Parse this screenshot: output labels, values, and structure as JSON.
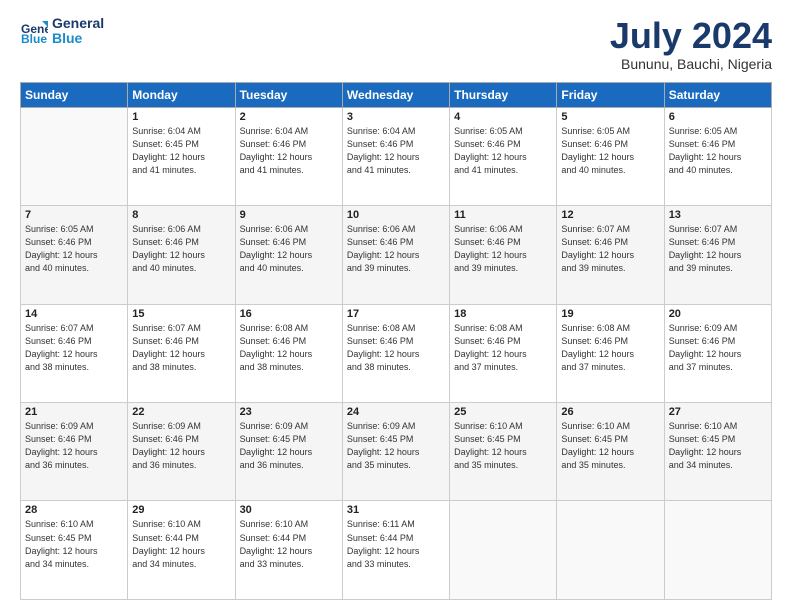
{
  "header": {
    "logo_line1": "General",
    "logo_line2": "Blue",
    "month": "July 2024",
    "location": "Bununu, Bauchi, Nigeria"
  },
  "weekdays": [
    "Sunday",
    "Monday",
    "Tuesday",
    "Wednesday",
    "Thursday",
    "Friday",
    "Saturday"
  ],
  "rows": [
    [
      {
        "day": "",
        "info": ""
      },
      {
        "day": "1",
        "info": "Sunrise: 6:04 AM\nSunset: 6:45 PM\nDaylight: 12 hours\nand 41 minutes."
      },
      {
        "day": "2",
        "info": "Sunrise: 6:04 AM\nSunset: 6:46 PM\nDaylight: 12 hours\nand 41 minutes."
      },
      {
        "day": "3",
        "info": "Sunrise: 6:04 AM\nSunset: 6:46 PM\nDaylight: 12 hours\nand 41 minutes."
      },
      {
        "day": "4",
        "info": "Sunrise: 6:05 AM\nSunset: 6:46 PM\nDaylight: 12 hours\nand 41 minutes."
      },
      {
        "day": "5",
        "info": "Sunrise: 6:05 AM\nSunset: 6:46 PM\nDaylight: 12 hours\nand 40 minutes."
      },
      {
        "day": "6",
        "info": "Sunrise: 6:05 AM\nSunset: 6:46 PM\nDaylight: 12 hours\nand 40 minutes."
      }
    ],
    [
      {
        "day": "7",
        "info": "Sunrise: 6:05 AM\nSunset: 6:46 PM\nDaylight: 12 hours\nand 40 minutes."
      },
      {
        "day": "8",
        "info": "Sunrise: 6:06 AM\nSunset: 6:46 PM\nDaylight: 12 hours\nand 40 minutes."
      },
      {
        "day": "9",
        "info": "Sunrise: 6:06 AM\nSunset: 6:46 PM\nDaylight: 12 hours\nand 40 minutes."
      },
      {
        "day": "10",
        "info": "Sunrise: 6:06 AM\nSunset: 6:46 PM\nDaylight: 12 hours\nand 39 minutes."
      },
      {
        "day": "11",
        "info": "Sunrise: 6:06 AM\nSunset: 6:46 PM\nDaylight: 12 hours\nand 39 minutes."
      },
      {
        "day": "12",
        "info": "Sunrise: 6:07 AM\nSunset: 6:46 PM\nDaylight: 12 hours\nand 39 minutes."
      },
      {
        "day": "13",
        "info": "Sunrise: 6:07 AM\nSunset: 6:46 PM\nDaylight: 12 hours\nand 39 minutes."
      }
    ],
    [
      {
        "day": "14",
        "info": "Sunrise: 6:07 AM\nSunset: 6:46 PM\nDaylight: 12 hours\nand 38 minutes."
      },
      {
        "day": "15",
        "info": "Sunrise: 6:07 AM\nSunset: 6:46 PM\nDaylight: 12 hours\nand 38 minutes."
      },
      {
        "day": "16",
        "info": "Sunrise: 6:08 AM\nSunset: 6:46 PM\nDaylight: 12 hours\nand 38 minutes."
      },
      {
        "day": "17",
        "info": "Sunrise: 6:08 AM\nSunset: 6:46 PM\nDaylight: 12 hours\nand 38 minutes."
      },
      {
        "day": "18",
        "info": "Sunrise: 6:08 AM\nSunset: 6:46 PM\nDaylight: 12 hours\nand 37 minutes."
      },
      {
        "day": "19",
        "info": "Sunrise: 6:08 AM\nSunset: 6:46 PM\nDaylight: 12 hours\nand 37 minutes."
      },
      {
        "day": "20",
        "info": "Sunrise: 6:09 AM\nSunset: 6:46 PM\nDaylight: 12 hours\nand 37 minutes."
      }
    ],
    [
      {
        "day": "21",
        "info": "Sunrise: 6:09 AM\nSunset: 6:46 PM\nDaylight: 12 hours\nand 36 minutes."
      },
      {
        "day": "22",
        "info": "Sunrise: 6:09 AM\nSunset: 6:46 PM\nDaylight: 12 hours\nand 36 minutes."
      },
      {
        "day": "23",
        "info": "Sunrise: 6:09 AM\nSunset: 6:45 PM\nDaylight: 12 hours\nand 36 minutes."
      },
      {
        "day": "24",
        "info": "Sunrise: 6:09 AM\nSunset: 6:45 PM\nDaylight: 12 hours\nand 35 minutes."
      },
      {
        "day": "25",
        "info": "Sunrise: 6:10 AM\nSunset: 6:45 PM\nDaylight: 12 hours\nand 35 minutes."
      },
      {
        "day": "26",
        "info": "Sunrise: 6:10 AM\nSunset: 6:45 PM\nDaylight: 12 hours\nand 35 minutes."
      },
      {
        "day": "27",
        "info": "Sunrise: 6:10 AM\nSunset: 6:45 PM\nDaylight: 12 hours\nand 34 minutes."
      }
    ],
    [
      {
        "day": "28",
        "info": "Sunrise: 6:10 AM\nSunset: 6:45 PM\nDaylight: 12 hours\nand 34 minutes."
      },
      {
        "day": "29",
        "info": "Sunrise: 6:10 AM\nSunset: 6:44 PM\nDaylight: 12 hours\nand 34 minutes."
      },
      {
        "day": "30",
        "info": "Sunrise: 6:10 AM\nSunset: 6:44 PM\nDaylight: 12 hours\nand 33 minutes."
      },
      {
        "day": "31",
        "info": "Sunrise: 6:11 AM\nSunset: 6:44 PM\nDaylight: 12 hours\nand 33 minutes."
      },
      {
        "day": "",
        "info": ""
      },
      {
        "day": "",
        "info": ""
      },
      {
        "day": "",
        "info": ""
      }
    ]
  ]
}
